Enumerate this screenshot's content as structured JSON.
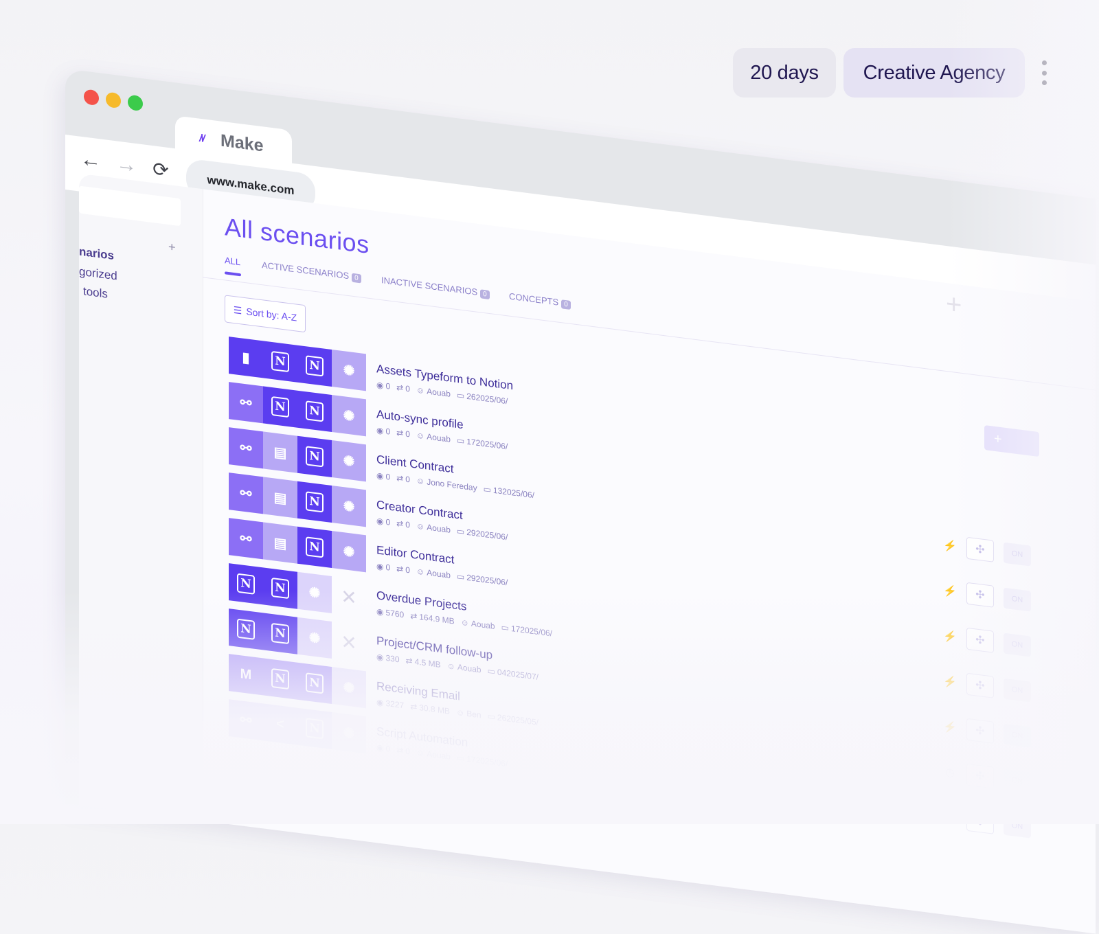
{
  "header": {
    "trial_label": "20 days",
    "workspace_label": "Creative Agency",
    "menu_icon": "kebab-icon"
  },
  "browser": {
    "tab_title": "Make",
    "tab_logo": "/\\/",
    "url": "www.make.com",
    "back_icon": "←",
    "forward_icon": "→",
    "reload_icon": "⟳"
  },
  "sidebar": {
    "plus": "+",
    "items": [
      "narios",
      "gorized",
      "tools"
    ]
  },
  "main": {
    "title": "All scenarios",
    "tabs": [
      {
        "label": "ALL",
        "count": ""
      },
      {
        "label": "ACTIVE SCENARIOS",
        "count": "0"
      },
      {
        "label": "INACTIVE SCENARIOS",
        "count": "0"
      },
      {
        "label": "CONCEPTS",
        "count": "0"
      }
    ],
    "sort_label": "Sort by: A-Z",
    "create_label": "+"
  },
  "colors": {
    "accent": "#6b4ff0",
    "tile_dark": "#5b3df0",
    "tile_mid": "#8c6ff5",
    "tile_light": "#b7a8f5",
    "tile_pale": "#dcd4fb"
  },
  "scenarios": [
    {
      "name": "Assets Typeform to Notion",
      "views": "0",
      "transfers": "0",
      "size": "",
      "user": "Aouab",
      "date": "262025/06/",
      "trigger": "bolt",
      "tiles": [
        {
          "icon": "typeform-icon",
          "shade": "tile_dark"
        },
        {
          "icon": "notion-icon",
          "shade": "tile_dark"
        },
        {
          "icon": "notion-icon",
          "shade": "tile_dark"
        },
        {
          "icon": "gear-icon",
          "shade": "tile_light"
        }
      ]
    },
    {
      "name": "Auto-sync profile",
      "views": "0",
      "transfers": "0",
      "size": "",
      "user": "Aouab",
      "date": "172025/06/",
      "trigger": "bolt",
      "tiles": [
        {
          "icon": "webhook-icon",
          "shade": "tile_mid"
        },
        {
          "icon": "notion-icon",
          "shade": "tile_dark"
        },
        {
          "icon": "notion-icon",
          "shade": "tile_dark"
        },
        {
          "icon": "gear-icon",
          "shade": "tile_light"
        }
      ]
    },
    {
      "name": "Client Contract",
      "views": "0",
      "transfers": "0",
      "size": "",
      "user": "Jono Fereday",
      "date": "132025/06/",
      "trigger": "bolt",
      "tiles": [
        {
          "icon": "webhook-icon",
          "shade": "tile_mid"
        },
        {
          "icon": "document-icon",
          "shade": "tile_light"
        },
        {
          "icon": "notion-icon",
          "shade": "tile_dark"
        },
        {
          "icon": "gear-icon",
          "shade": "tile_light"
        }
      ]
    },
    {
      "name": "Creator Contract",
      "views": "0",
      "transfers": "0",
      "size": "",
      "user": "Aouab",
      "date": "292025/06/",
      "trigger": "bolt",
      "tiles": [
        {
          "icon": "webhook-icon",
          "shade": "tile_mid"
        },
        {
          "icon": "document-icon",
          "shade": "tile_light"
        },
        {
          "icon": "notion-icon",
          "shade": "tile_dark"
        },
        {
          "icon": "gear-icon",
          "shade": "tile_light"
        }
      ]
    },
    {
      "name": "Editor Contract",
      "views": "0",
      "transfers": "0",
      "size": "",
      "user": "Aouab",
      "date": "292025/06/",
      "trigger": "bolt",
      "tiles": [
        {
          "icon": "webhook-icon",
          "shade": "tile_mid"
        },
        {
          "icon": "document-icon",
          "shade": "tile_light"
        },
        {
          "icon": "notion-icon",
          "shade": "tile_dark"
        },
        {
          "icon": "gear-icon",
          "shade": "tile_light"
        }
      ]
    },
    {
      "name": "Overdue Projects",
      "views": "5760",
      "transfers": "164.9 MB",
      "size": "",
      "user": "Aouab",
      "date": "172025/06/",
      "trigger": "bolt",
      "tiles": [
        {
          "icon": "notion-icon",
          "shade": "tile_dark"
        },
        {
          "icon": "notion-icon",
          "shade": "tile_dark"
        },
        {
          "icon": "gear-icon",
          "shade": "tile_pale"
        },
        {
          "icon": "cross-icon",
          "shade": "none"
        }
      ]
    },
    {
      "name": "Project/CRM follow-up",
      "views": "330",
      "transfers": "4.5 MB",
      "size": "",
      "user": "Aouab",
      "date": "042025/07/",
      "trigger": "bolt",
      "tiles": [
        {
          "icon": "notion-icon",
          "shade": "tile_dark"
        },
        {
          "icon": "notion-icon",
          "shade": "tile_dark"
        },
        {
          "icon": "gear-icon",
          "shade": "tile_pale"
        },
        {
          "icon": "cross-icon",
          "shade": "none"
        }
      ]
    },
    {
      "name": "Receiving Email",
      "views": "3227",
      "transfers": "30.8 MB",
      "size": "",
      "user": "Ben",
      "date": "262025/05/",
      "trigger": "clock",
      "tiles": [
        {
          "icon": "gmail-icon",
          "shade": "tile_mid"
        },
        {
          "icon": "notion-icon",
          "shade": "tile_mid"
        },
        {
          "icon": "notion-icon",
          "shade": "tile_mid"
        },
        {
          "icon": "gear-icon",
          "shade": "tile_pale"
        }
      ]
    },
    {
      "name": "Script Automation",
      "views": "0",
      "transfers": "0",
      "size": "",
      "user": "Aouab",
      "date": "172025/06/",
      "trigger": "clock",
      "tiles": [
        {
          "icon": "webhook-icon",
          "shade": "tile_light"
        },
        {
          "icon": "share-icon",
          "shade": "tile_light"
        },
        {
          "icon": "notion-icon",
          "shade": "tile_light"
        },
        {
          "icon": "gear-icon",
          "shade": "tile_pale"
        }
      ]
    }
  ],
  "row_actions": {
    "toggle_label": "ON",
    "flow_icon": "flow-icon"
  }
}
